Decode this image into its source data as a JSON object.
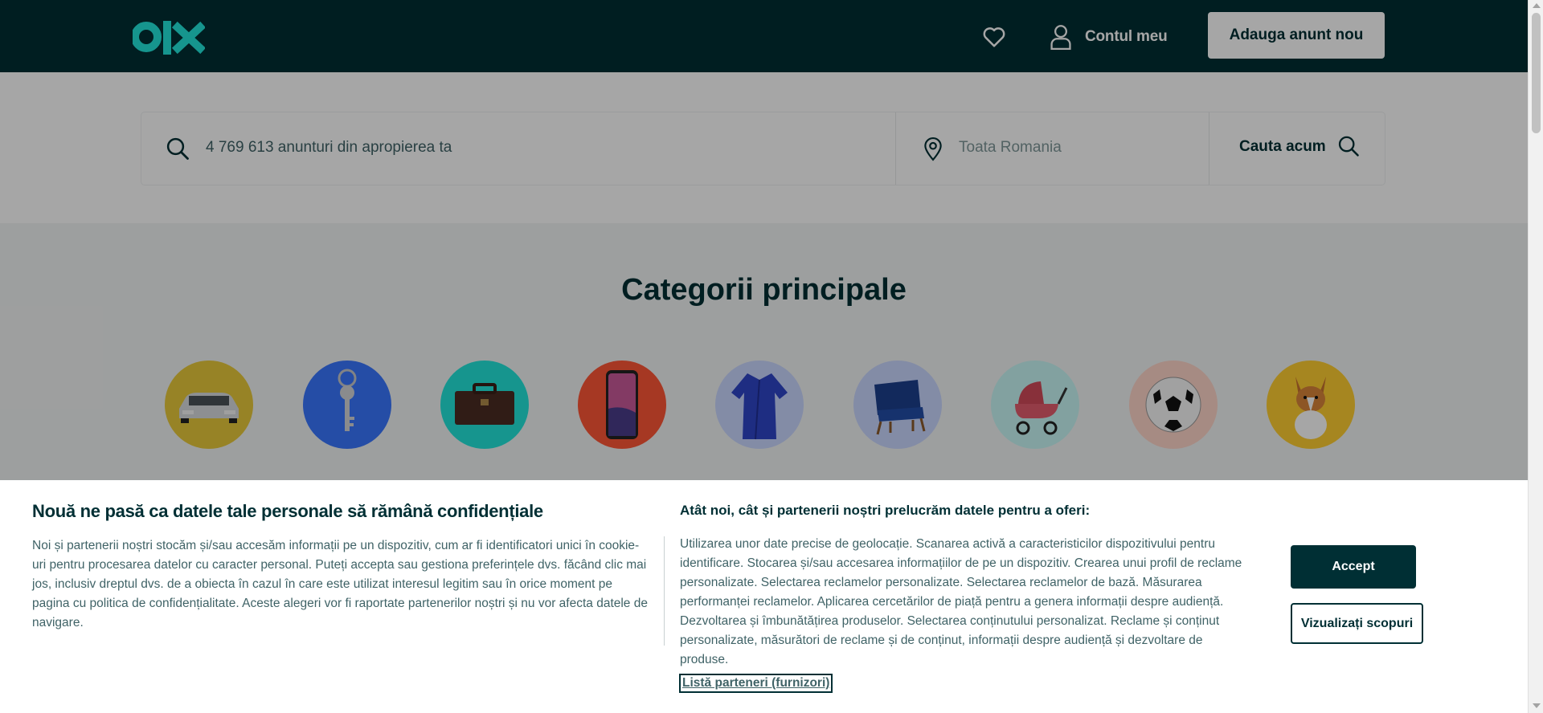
{
  "header": {
    "logo_text": "olx",
    "account_label": "Contul meu",
    "post_button_label": "Adauga anunt nou",
    "favorites_icon": "heart-icon",
    "account_icon": "user-icon"
  },
  "search": {
    "query_placeholder": "4 769 613 anunturi din apropierea ta",
    "location_placeholder": "Toata Romania",
    "button_label": "Cauta acum"
  },
  "categories": {
    "title": "Categorii principale",
    "items": [
      {
        "icon": "car-icon",
        "bg": "#e8c93b"
      },
      {
        "icon": "key-icon",
        "bg": "#3a77ff"
      },
      {
        "icon": "briefcase-icon",
        "bg": "#23e5db"
      },
      {
        "icon": "phone-icon",
        "bg": "#ff5636"
      },
      {
        "icon": "robe-icon",
        "bg": "#cad7ff"
      },
      {
        "icon": "armchair-icon",
        "bg": "#cad7ff"
      },
      {
        "icon": "stroller-icon",
        "bg": "#c8f8f6"
      },
      {
        "icon": "football-icon",
        "bg": "#ffd6c9"
      },
      {
        "icon": "dog-icon",
        "bg": "#ffce32"
      }
    ]
  },
  "cookie": {
    "title": "Nouă ne pasă ca datele tale personale să rămână confidențiale",
    "text": "Noi și partenerii noștri stocăm și/sau accesăm informații pe un dispozitiv, cum ar fi identificatori unici în cookie-uri pentru procesarea datelor cu caracter personal. Puteți accepta sau gestiona preferințele dvs. făcând clic mai jos, inclusiv dreptul dvs. de a obiecta în cazul în care este utilizat interesul legitim sau în orice moment pe pagina cu politica de confidențialitate. Aceste alegeri vor fi raportate partenerilor noștri și nu vor afecta datele de navigare.",
    "purposes_title": "Atât noi, cât și partenerii noștri prelucrăm datele pentru a oferi:",
    "purposes_text": "Utilizarea unor date precise de geolocație. Scanarea activă a caracteristicilor dispozitivului pentru identificare. Stocarea și/sau accesarea informațiilor de pe un dispozitiv. Crearea unui profil de reclame personalizate. Selectarea reclamelor personalizate. Selectarea reclamelor de bază. Măsurarea performanței reclamelor. Aplicarea cercetărilor de piață pentru a genera informații despre audiență. Dezvoltarea și îmbunătățirea produselor. Selectarea conținutului personalizat. Reclame și conținut personalizate, măsurători de reclame și de conținut, informații despre audiență și dezvoltare de produse.",
    "partners_link": "Listă parteneri (furnizori)",
    "accept_label": "Accept",
    "purposes_button_label": "Vizualizați scopuri"
  },
  "colors": {
    "brand_dark": "#002f34",
    "brand_accent": "#23e5db"
  }
}
